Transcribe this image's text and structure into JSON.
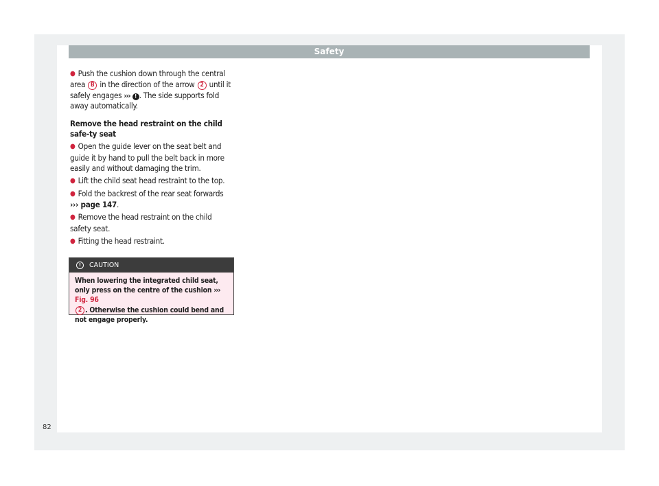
{
  "header": {
    "title": "Safety"
  },
  "bullets_top": {
    "p1_a": "Push the cushion down through the central area ",
    "p1_badge_b": "B",
    "p1_b": " in the direction of the arrow ",
    "p1_badge_2": "2",
    "p1_c": " until it safely engages ",
    "p1_arrow": "›››",
    "p1_d": ". The side supports fold away automatically."
  },
  "section": {
    "heading": "Remove the head restraint on the child safe-ty seat",
    "items": [
      "Open the guide lever on the seat belt and guide it by hand to pull the belt back in more easily and without damaging the trim.",
      "Lift the child seat head restraint to the top."
    ],
    "fold_a": "Fold the backrest of the rear seat forwards",
    "fold_link": "››› page 147",
    "fold_end": ".",
    "items_after": [
      "Remove the head restraint on the child safety seat.",
      "Fitting the head restraint."
    ]
  },
  "caution": {
    "label": "CAUTION",
    "text_a": "When lowering the integrated child seat, only press on the centre of the cushion ",
    "arrow": "›››",
    "fig_ref": " Fig. 96",
    "badge": "2",
    "text_b": ". Otherwise the cushion could bend and not engage properly."
  },
  "footer": {
    "page_number": "82"
  },
  "colors": {
    "accent": "#d0243e",
    "header_bar": "#a9b3b5",
    "caution_bg": "#fdeaf0",
    "caution_head": "#3c3c3c"
  }
}
